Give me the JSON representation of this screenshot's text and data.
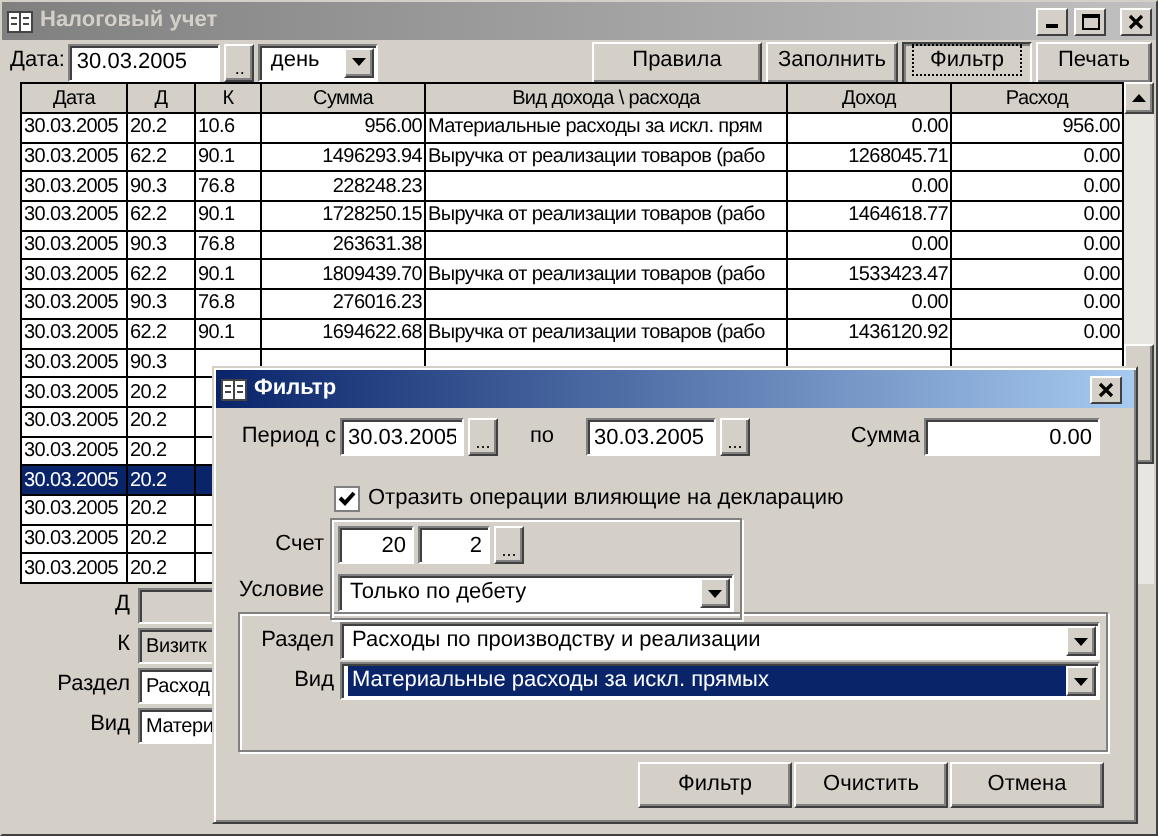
{
  "window": {
    "title": "Налоговый учет",
    "active": false
  },
  "toolbar": {
    "date_label": "Дата:",
    "date": "30.03.2005",
    "date_button": "..",
    "period": "день",
    "buttons": [
      {
        "label": "Правила",
        "pressed": false
      },
      {
        "label": "Заполнить",
        "pressed": false
      },
      {
        "label": "Фильтр",
        "pressed": true
      },
      {
        "label": "Печать",
        "pressed": false
      }
    ]
  },
  "table": {
    "columns": [
      "Дата",
      "Д",
      "К",
      "Сумма",
      "Вид дохода \\ расхода",
      "Доход",
      "Расход"
    ],
    "rows": [
      {
        "cells": [
          "30.03.2005",
          "20.2",
          "10.6",
          "956.00",
          "Материальные расходы за искл. прям",
          "0.00",
          "956.00"
        ],
        "selected": false
      },
      {
        "cells": [
          "30.03.2005",
          "62.2",
          "90.1",
          "1496293.94",
          "Выручка от реализации товаров (рабо",
          "1268045.71",
          "0.00"
        ],
        "selected": false
      },
      {
        "cells": [
          "30.03.2005",
          "90.3",
          "76.8",
          "228248.23",
          "",
          "0.00",
          "0.00"
        ],
        "selected": false
      },
      {
        "cells": [
          "30.03.2005",
          "62.2",
          "90.1",
          "1728250.15",
          "Выручка от реализации товаров (рабо",
          "1464618.77",
          "0.00"
        ],
        "selected": false
      },
      {
        "cells": [
          "30.03.2005",
          "90.3",
          "76.8",
          "263631.38",
          "",
          "0.00",
          "0.00"
        ],
        "selected": false
      },
      {
        "cells": [
          "30.03.2005",
          "62.2",
          "90.1",
          "1809439.70",
          "Выручка от реализации товаров (рабо",
          "1533423.47",
          "0.00"
        ],
        "selected": false
      },
      {
        "cells": [
          "30.03.2005",
          "90.3",
          "76.8",
          "276016.23",
          "",
          "0.00",
          "0.00"
        ],
        "selected": false
      },
      {
        "cells": [
          "30.03.2005",
          "62.2",
          "90.1",
          "1694622.68",
          "Выручка от реализации товаров (рабо",
          "1436120.92",
          "0.00"
        ],
        "selected": false
      },
      {
        "cells": [
          "30.03.2005",
          "90.3"
        ],
        "selected": false
      },
      {
        "cells": [
          "30.03.2005",
          "20.2"
        ],
        "selected": false
      },
      {
        "cells": [
          "30.03.2005",
          "20.2"
        ],
        "selected": false
      },
      {
        "cells": [
          "30.03.2005",
          "20.2"
        ],
        "selected": false
      },
      {
        "cells": [
          "30.03.2005",
          "20.2"
        ],
        "selected": true
      },
      {
        "cells": [
          "30.03.2005",
          "20.2"
        ],
        "selected": false
      },
      {
        "cells": [
          "30.03.2005",
          "20.2"
        ],
        "selected": false
      },
      {
        "cells": [
          "30.03.2005",
          "20.2"
        ],
        "selected": false
      }
    ]
  },
  "details": [
    {
      "label": "Д",
      "editable": false
    },
    {
      "label": "К",
      "value": "Визитк",
      "editable": false
    },
    {
      "label": "Раздел",
      "value": "Расход",
      "editable": true
    },
    {
      "label": "Вид",
      "value": "Матери",
      "editable": true
    }
  ],
  "dialog": {
    "title": "Фильтр",
    "period_from_label": "Период с",
    "period_from": "30.03.2005",
    "period_to_label": "по",
    "period_to": "30.03.2005",
    "browse_button": "...",
    "sum_label": "Сумма",
    "sum": "0.00",
    "declaration_checkbox": {
      "label": "Отразить операции влияющие на декларацию",
      "checked": true
    },
    "account_label": "Счет",
    "account": "20",
    "subaccount": "2",
    "account_button": "...",
    "condition_label": "Условие",
    "condition": "Только по дебету",
    "selects": [
      {
        "label": "Раздел",
        "value": "Расходы по производству и реализации",
        "highlighted": false
      },
      {
        "label": "Вид",
        "value": "Материальные расходы за искл. прямых",
        "highlighted": true
      }
    ],
    "buttons": [
      "Фильтр",
      "Очистить",
      "Отмена"
    ]
  }
}
